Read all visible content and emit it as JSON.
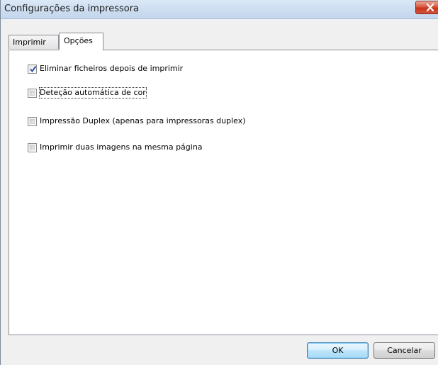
{
  "window": {
    "title": "Configurações da impressora"
  },
  "tabs": [
    {
      "label": "Imprimir",
      "selected": false
    },
    {
      "label": "Opções",
      "selected": true
    }
  ],
  "options": [
    {
      "label": "Eliminar ficheiros depois de imprimir",
      "checked": true
    },
    {
      "label": "Deteção automática de cor",
      "checked": false,
      "focused": true
    },
    {
      "label": "Impressão Duplex (apenas para impressoras duplex)",
      "checked": false
    },
    {
      "label": "Imprimir duas imagens na mesma página",
      "checked": false
    }
  ],
  "buttons": {
    "ok_label": "OK",
    "cancel_label": "Cancelar"
  },
  "icons": {
    "close": "close-icon",
    "checkmark": "checkmark-icon"
  },
  "colors": {
    "close_button": "#d9573f",
    "check_accent": "#2c5aa0",
    "default_button_border": "#3c7fb1"
  }
}
